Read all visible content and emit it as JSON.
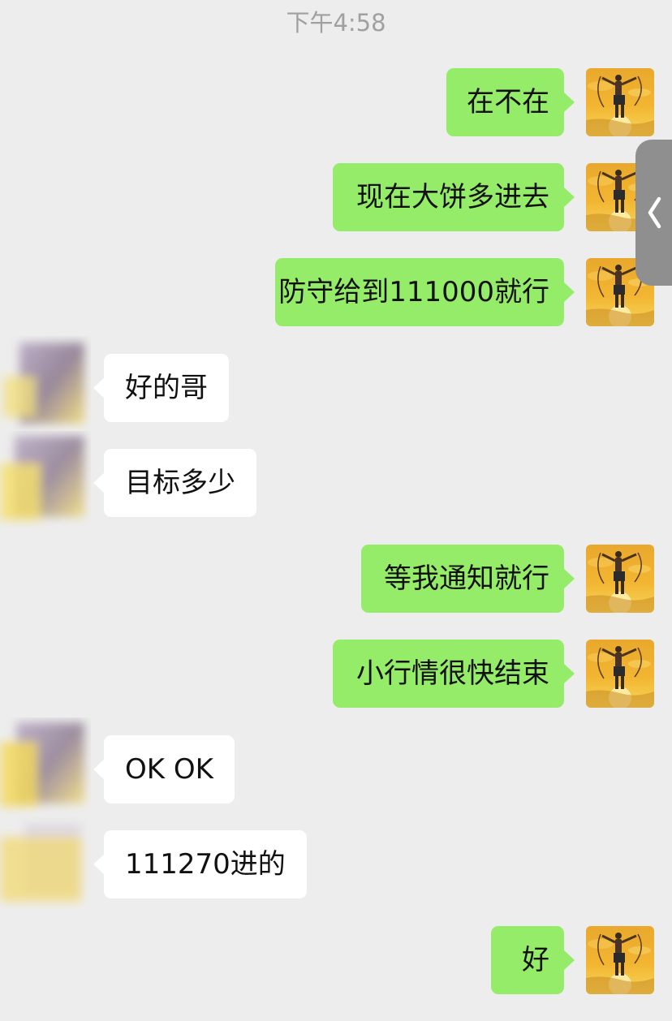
{
  "chat": {
    "timestamp": "下午4:58",
    "messages": [
      {
        "from": "self",
        "text": "在不在"
      },
      {
        "from": "self",
        "text": "现在大饼多进去"
      },
      {
        "from": "self",
        "text": "防守给到111000就行"
      },
      {
        "from": "other",
        "text": "好的哥"
      },
      {
        "from": "other",
        "text": "目标多少"
      },
      {
        "from": "self",
        "text": "等我通知就行"
      },
      {
        "from": "self",
        "text": "小行情很快结束"
      },
      {
        "from": "other",
        "text": "OK OK"
      },
      {
        "from": "other",
        "text": "111270进的"
      },
      {
        "from": "self",
        "text": "好"
      }
    ]
  },
  "side_handle": {
    "icon": "chevron-left-icon"
  },
  "colors": {
    "background": "#ededed",
    "outgoing_bubble": "#95ec69",
    "incoming_bubble": "#ffffff",
    "timestamp_text": "#a0a0a0"
  }
}
